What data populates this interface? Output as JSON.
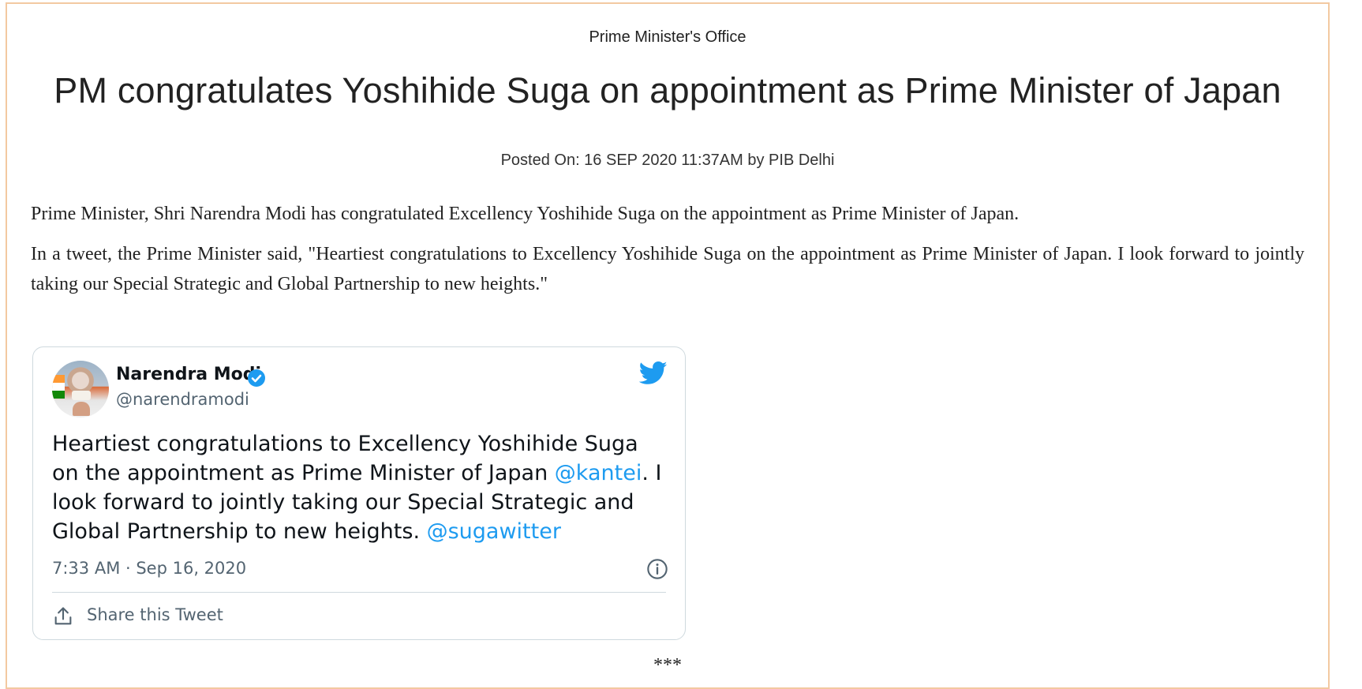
{
  "header": {
    "ministry": "Prime Minister's Office",
    "title": "PM congratulates Yoshihide Suga on appointment as Prime Minister of Japan",
    "posted": "Posted On: 16 SEP 2020 11:37AM by PIB Delhi"
  },
  "body": {
    "paragraph1": "Prime Minister, Shri Narendra Modi has congratulated Excellency Yoshihide Suga on the appointment as Prime Minister of Japan.",
    "paragraph2": "In a tweet, the Prime Minister said, \"Heartiest congratulations to Excellency Yoshihide Suga on the appointment as Prime Minister of Japan. I look forward to jointly taking our Special Strategic and Global Partnership to new heights.\""
  },
  "tweet": {
    "display_name": "Narendra Modi",
    "handle": "@narendramodi",
    "text_part1": "Heartiest congratulations to Excellency Yoshihide Suga on the appointment as Prime Minister of Japan ",
    "mention1": "@kantei",
    "text_part2": ". I look forward to jointly taking our Special Strategic and Global Partnership to new heights. ",
    "mention2": "@sugawitter",
    "timestamp": "7:33 AM · Sep 16, 2020",
    "share_label": "Share this Tweet",
    "icons": {
      "avatar": "avatar",
      "verified": "verified-badge-icon",
      "brand": "twitter-bird-icon",
      "info": "info-icon",
      "share": "share-icon"
    },
    "colors": {
      "mention": "#1d9bf0",
      "verified": "#1d9bf0",
      "brand": "#1d9bf0",
      "muted_text": "#536471",
      "border": "#cfd9de"
    }
  },
  "footer": {
    "separator": "***"
  },
  "colors": {
    "frame_border": "#f3c9a1"
  }
}
